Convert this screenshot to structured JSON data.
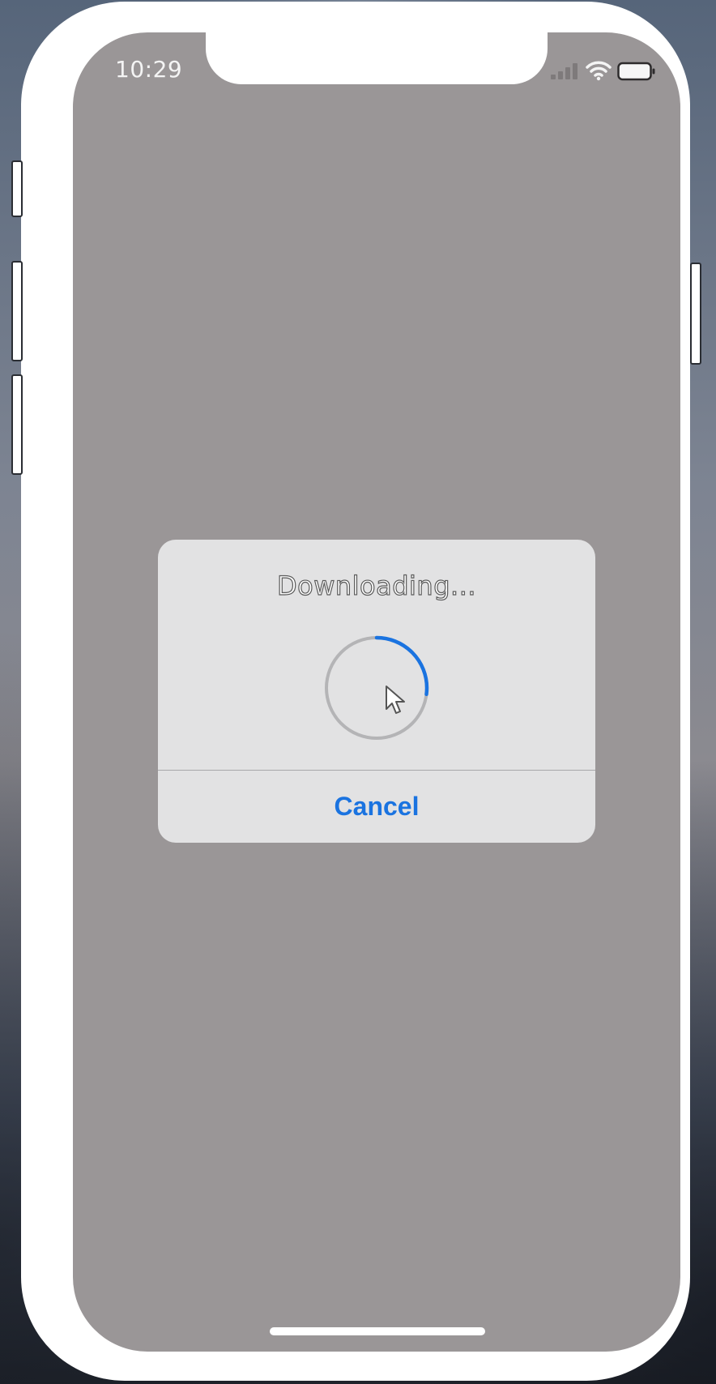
{
  "status_bar": {
    "time": "10:29",
    "icons": [
      "signal-icon",
      "wifi-icon",
      "battery-icon"
    ]
  },
  "alert": {
    "title": "Downloading...",
    "progress_fraction": 0.27,
    "cancel_label": "Cancel"
  },
  "colors": {
    "accent": "#1a73e0",
    "dim_overlay": "#9a9697",
    "alert_background": "#e2e2e3",
    "ring_track": "#b4b4b6"
  }
}
